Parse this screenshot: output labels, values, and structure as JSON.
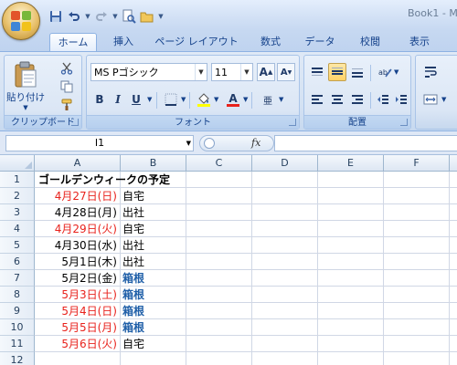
{
  "window": {
    "title": "Book1 - M"
  },
  "tabs": [
    "ホーム",
    "挿入",
    "ページ レイアウト",
    "数式",
    "データ",
    "校閲",
    "表示"
  ],
  "active_tab": "ホーム",
  "ribbon": {
    "clipboard": {
      "paste_label": "貼り付け",
      "group_label": "クリップボード"
    },
    "font": {
      "font_name": "MS Pゴシック",
      "font_size": "11",
      "group_label": "フォント",
      "bold": "B",
      "italic": "I",
      "underline": "U",
      "grow": "A",
      "shrink": "A",
      "phonetic": "亜"
    },
    "alignment": {
      "group_label": "配置"
    }
  },
  "formula_bar": {
    "name_box": "I1",
    "fx_label": "fx",
    "formula": ""
  },
  "sheet": {
    "columns": [
      "A",
      "B",
      "C",
      "D",
      "E",
      "F"
    ],
    "rows": [
      "1",
      "2",
      "3",
      "4",
      "5",
      "6",
      "7",
      "8",
      "9",
      "10",
      "11",
      "12"
    ],
    "title": "ゴールデンウィークの予定",
    "entries": [
      {
        "date": "4月27日(日)",
        "plan": "自宅",
        "date_color": "red",
        "plan_style": "normal"
      },
      {
        "date": "4月28日(月)",
        "plan": "出社",
        "date_color": "black",
        "plan_style": "normal"
      },
      {
        "date": "4月29日(火)",
        "plan": "自宅",
        "date_color": "red",
        "plan_style": "normal"
      },
      {
        "date": "4月30日(水)",
        "plan": "出社",
        "date_color": "black",
        "plan_style": "normal"
      },
      {
        "date": "5月1日(木)",
        "plan": "出社",
        "date_color": "black",
        "plan_style": "normal"
      },
      {
        "date": "5月2日(金)",
        "plan": "箱根",
        "date_color": "black",
        "plan_style": "blue-bold"
      },
      {
        "date": "5月3日(土)",
        "plan": "箱根",
        "date_color": "red",
        "plan_style": "blue-bold"
      },
      {
        "date": "5月4日(日)",
        "plan": "箱根",
        "date_color": "red",
        "plan_style": "blue-bold"
      },
      {
        "date": "5月5日(月)",
        "plan": "箱根",
        "date_color": "red",
        "plan_style": "blue-bold"
      },
      {
        "date": "5月6日(火)",
        "plan": "自宅",
        "date_color": "red",
        "plan_style": "normal"
      }
    ]
  },
  "colors": {
    "holiday": "#e8221c",
    "trip": "#1f5fa8",
    "ribbon": "#dfe9f6"
  }
}
